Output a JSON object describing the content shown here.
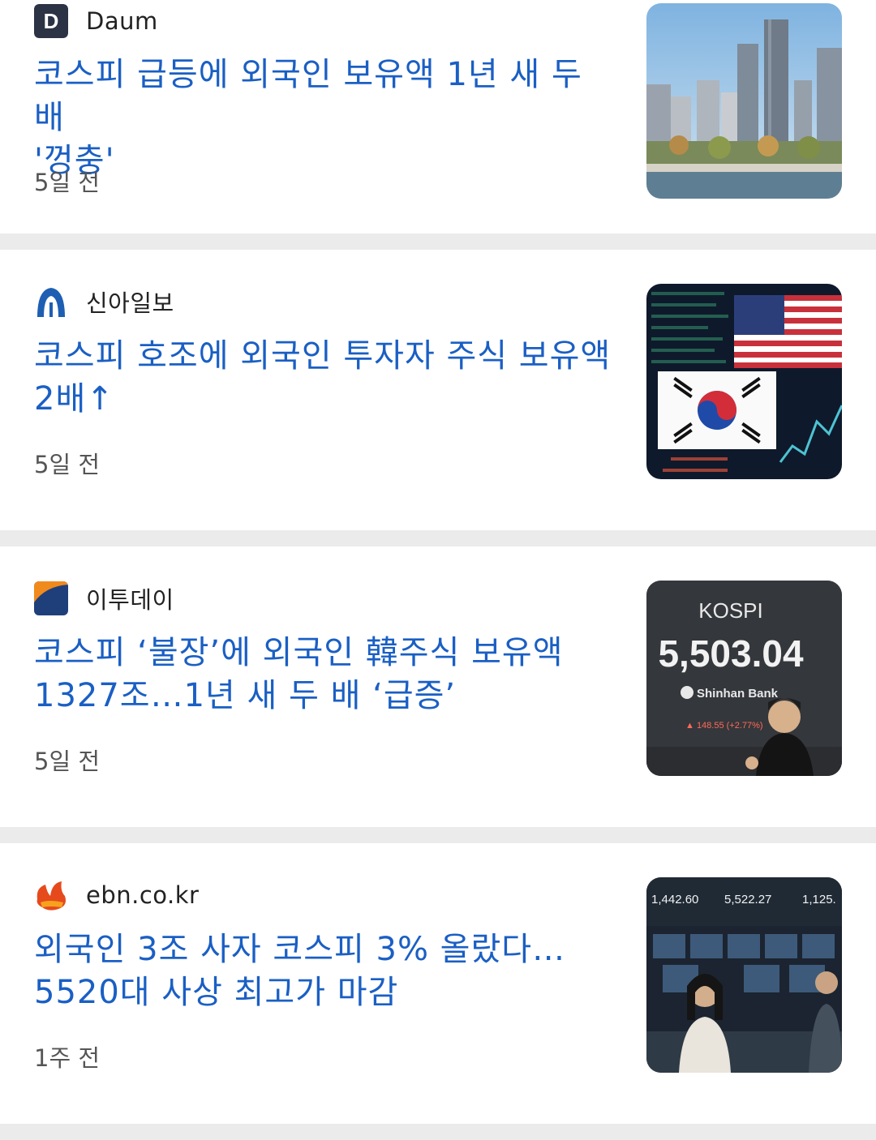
{
  "articles": [
    {
      "source": "Daum",
      "source_icon": "daum-logo-icon",
      "headline_line1": "코스피 급등에 외국인 보유액 1년 새 두 배",
      "headline_line2": "'껑충'",
      "time": "5일 전",
      "thumbnail": "city-skyline-thumbnail"
    },
    {
      "source": "신아일보",
      "source_icon": "shinailbo-logo-icon",
      "headline_line1": "코스피 호조에 외국인 투자자 주식 보유액",
      "headline_line2": "2배↑",
      "time": "5일 전",
      "thumbnail": "flags-stock-board-thumbnail"
    },
    {
      "source": "이투데이",
      "source_icon": "etoday-logo-icon",
      "headline_line1": "코스피 ‘불장’에 외국인 韓주식 보유액",
      "headline_line2": "1327조…1년 새 두 배 ‘급증’",
      "time": "5일 전",
      "thumbnail": "kospi-board-thumbnail",
      "thumb_text": {
        "title": "KOSPI",
        "value": "5,503.04",
        "bank": "Shinhan Bank",
        "change": "▲ 148.55 (+2.77%)"
      }
    },
    {
      "source": "ebn.co.kr",
      "source_icon": "ebn-logo-icon",
      "headline_line1": "외국인 3조 사자 코스피 3% 올랐다…",
      "headline_line2": "5520대 사상 최고가 마감",
      "time": "1주 전",
      "thumbnail": "dealing-room-thumbnail",
      "thumb_text": {
        "v1": "1,442.60",
        "v2": "5,522.27",
        "v3": "1,125."
      }
    }
  ],
  "colors": {
    "headline": "#1a5fc4",
    "separator": "#ebebeb",
    "time": "#555555"
  }
}
